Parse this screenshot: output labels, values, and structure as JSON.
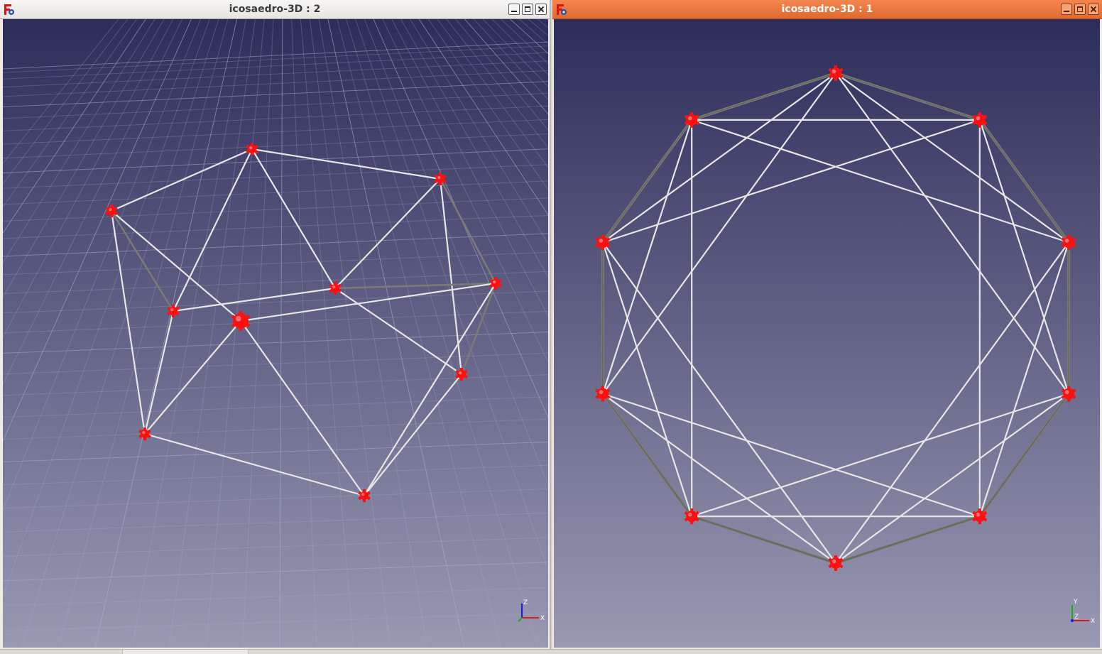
{
  "windows": [
    {
      "title": "icosaedro-3D : 2",
      "state": "inactive",
      "view": "axonometric",
      "axis_labels": [
        "Z",
        "X"
      ]
    },
    {
      "title": "icosaedro-3D : 1",
      "state": "active",
      "view": "top",
      "axis_labels": [
        "Y",
        "Z",
        "X"
      ]
    }
  ],
  "colors": {
    "background_top": "#2d2d5b",
    "background_bottom": "#9999b3",
    "edge_front": "#e6e6e6",
    "edge_back": "#7a7a74",
    "vertex": "#ff1010",
    "active_titlebar": "#ee7a3e",
    "grid": "#a9b0cc"
  },
  "icons": {
    "app": "freecad-gear-icon",
    "minimize": "minimize-icon",
    "maximize": "maximize-icon",
    "close": "close-icon",
    "axis_triad": "axis-triad-icon",
    "vertex": "vertex-marker-icon"
  }
}
